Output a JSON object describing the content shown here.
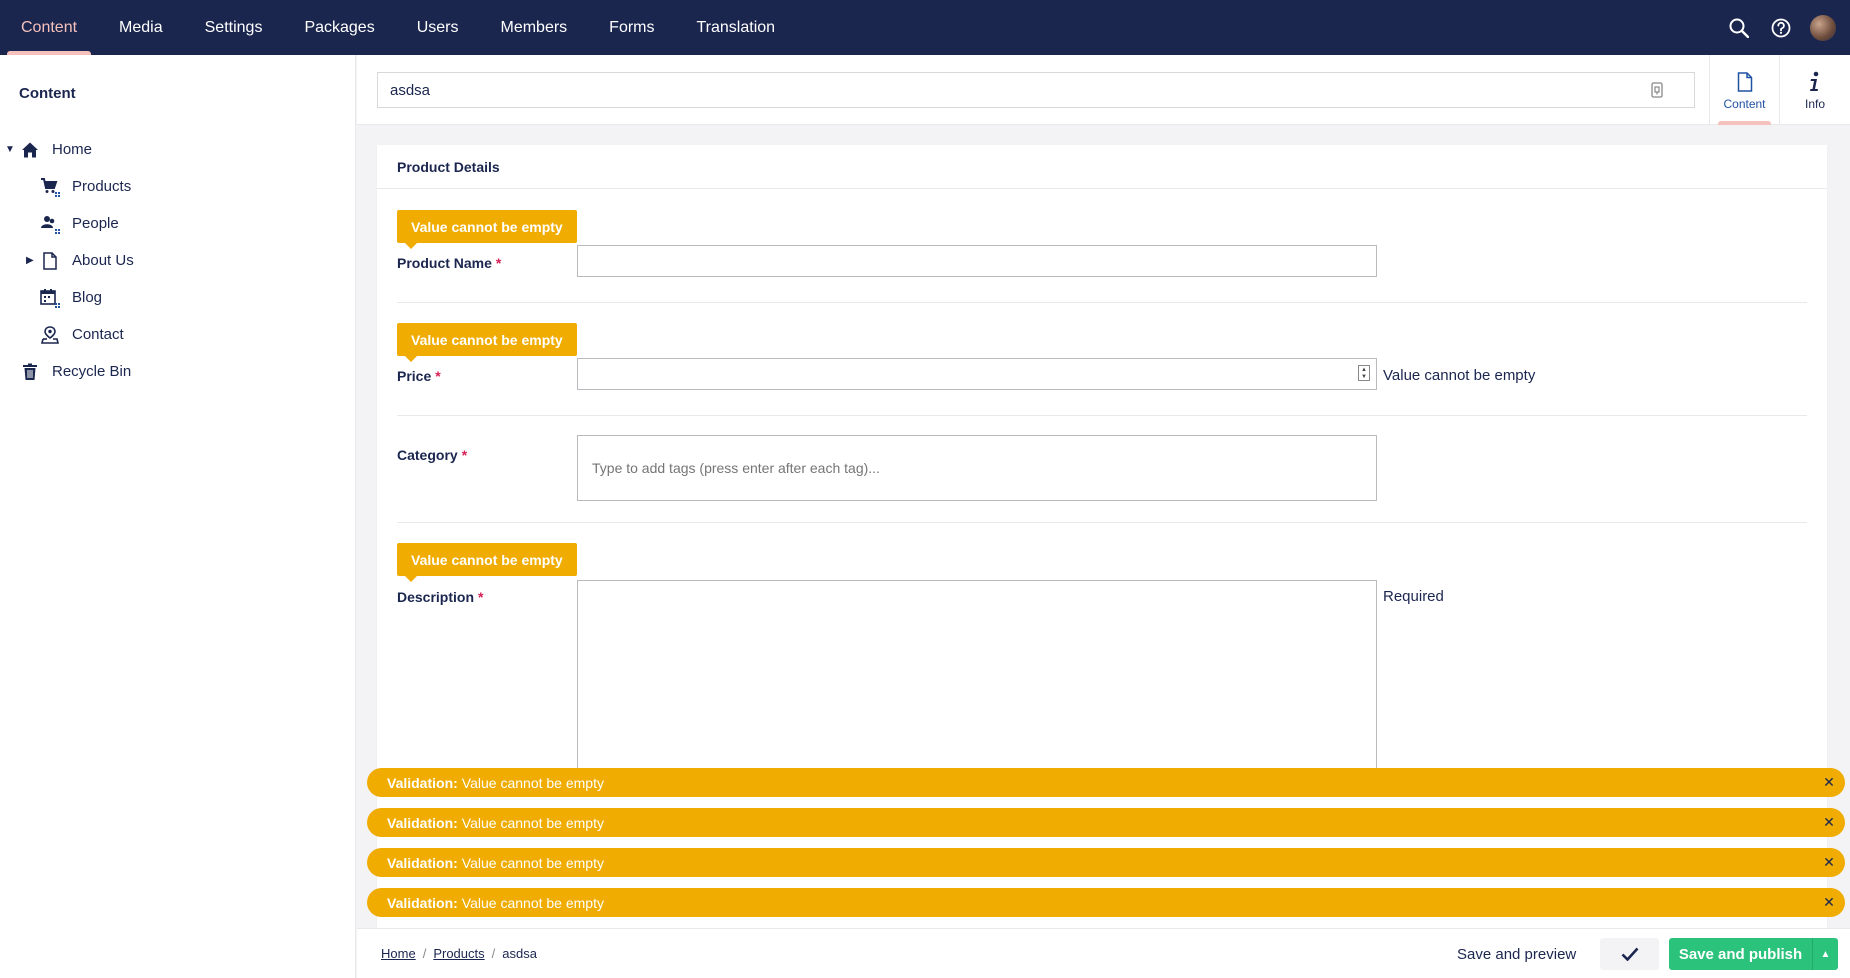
{
  "topnav": {
    "sections": [
      {
        "label": "Content",
        "active": true
      },
      {
        "label": "Media",
        "active": false
      },
      {
        "label": "Settings",
        "active": false
      },
      {
        "label": "Packages",
        "active": false
      },
      {
        "label": "Users",
        "active": false
      },
      {
        "label": "Members",
        "active": false
      },
      {
        "label": "Forms",
        "active": false
      },
      {
        "label": "Translation",
        "active": false
      }
    ],
    "icons": [
      "search-icon",
      "help-icon",
      "user-avatar"
    ]
  },
  "sidebar": {
    "title": "Content",
    "tree": [
      {
        "label": "Home",
        "icon": "home-icon",
        "expanded": true
      },
      {
        "label": "Products",
        "icon": "shopping-cart-icon"
      },
      {
        "label": "People",
        "icon": "people-icon"
      },
      {
        "label": "About Us",
        "icon": "document-icon",
        "has_children": true
      },
      {
        "label": "Blog",
        "icon": "calendar-icon"
      },
      {
        "label": "Contact",
        "icon": "map-location-icon"
      },
      {
        "label": "Recycle Bin",
        "icon": "trash-icon"
      }
    ]
  },
  "editor": {
    "node_name": "asdsa",
    "apps": [
      {
        "label": "Content",
        "icon": "document-icon",
        "active": true
      },
      {
        "label": "Info",
        "icon": "info-icon",
        "active": false
      }
    ],
    "group_title": "Product Details",
    "properties": [
      {
        "label": "Product Name",
        "required_mark": "*",
        "validation": "Value cannot be empty",
        "value": "",
        "message": ""
      },
      {
        "label": "Price",
        "required_mark": "*",
        "validation": "Value cannot be empty",
        "value": "",
        "message": "Value cannot be empty"
      },
      {
        "label": "Category",
        "required_mark": "*",
        "validation": "",
        "placeholder": "Type to add tags (press enter after each tag)...",
        "message": ""
      },
      {
        "label": "Description",
        "required_mark": "*",
        "validation": "Value cannot be empty",
        "value": "",
        "message": "Required"
      }
    ]
  },
  "notifications": [
    {
      "prefix": "Validation:",
      "text": "Value cannot be empty"
    },
    {
      "prefix": "Validation:",
      "text": "Value cannot be empty"
    },
    {
      "prefix": "Validation:",
      "text": "Value cannot be empty"
    },
    {
      "prefix": "Validation:",
      "text": "Value cannot be empty"
    }
  ],
  "footer": {
    "breadcrumb": [
      "Home",
      "Products",
      "asdsa"
    ],
    "save_preview_label": "Save and preview",
    "publish_label": "Save and publish"
  },
  "colors": {
    "nav_bg": "#1b264f",
    "active_accent": "#f5c1bc",
    "warning": "#f0ac00",
    "success": "#2bc37c"
  }
}
